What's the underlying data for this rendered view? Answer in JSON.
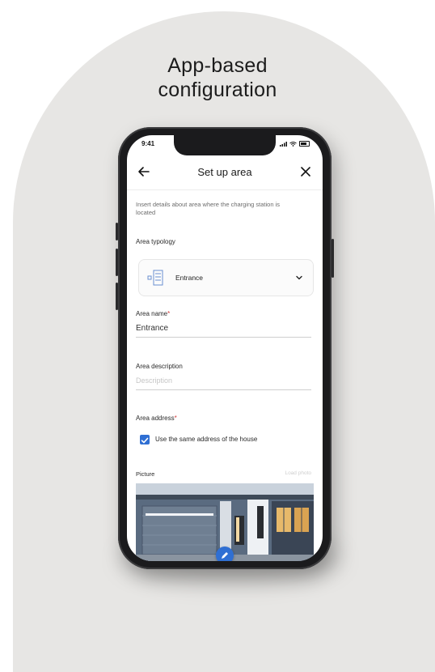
{
  "headline": {
    "line1": "App-based",
    "line2": "configuration"
  },
  "status_bar": {
    "time": "9:41"
  },
  "app_bar": {
    "title": "Set up area",
    "back_icon": "arrow-left-icon",
    "close_icon": "close-icon"
  },
  "form": {
    "description": "Insert details about area where the charging station is located",
    "area_typology": {
      "label": "Area typology",
      "value": "Entrance"
    },
    "area_name": {
      "label": "Area name",
      "required_mark": "*",
      "value": "Entrance"
    },
    "area_description": {
      "label": "Area description",
      "placeholder": "Description"
    },
    "area_address": {
      "label": "Area address",
      "required_mark": "*",
      "checkbox_label": "Use the same address of the house",
      "checked": true
    },
    "picture": {
      "label": "Picture",
      "action": "Load photo"
    }
  },
  "colors": {
    "accent": "#2f6fd3",
    "background": "#e7e6e4",
    "required": "#d23b3b"
  }
}
